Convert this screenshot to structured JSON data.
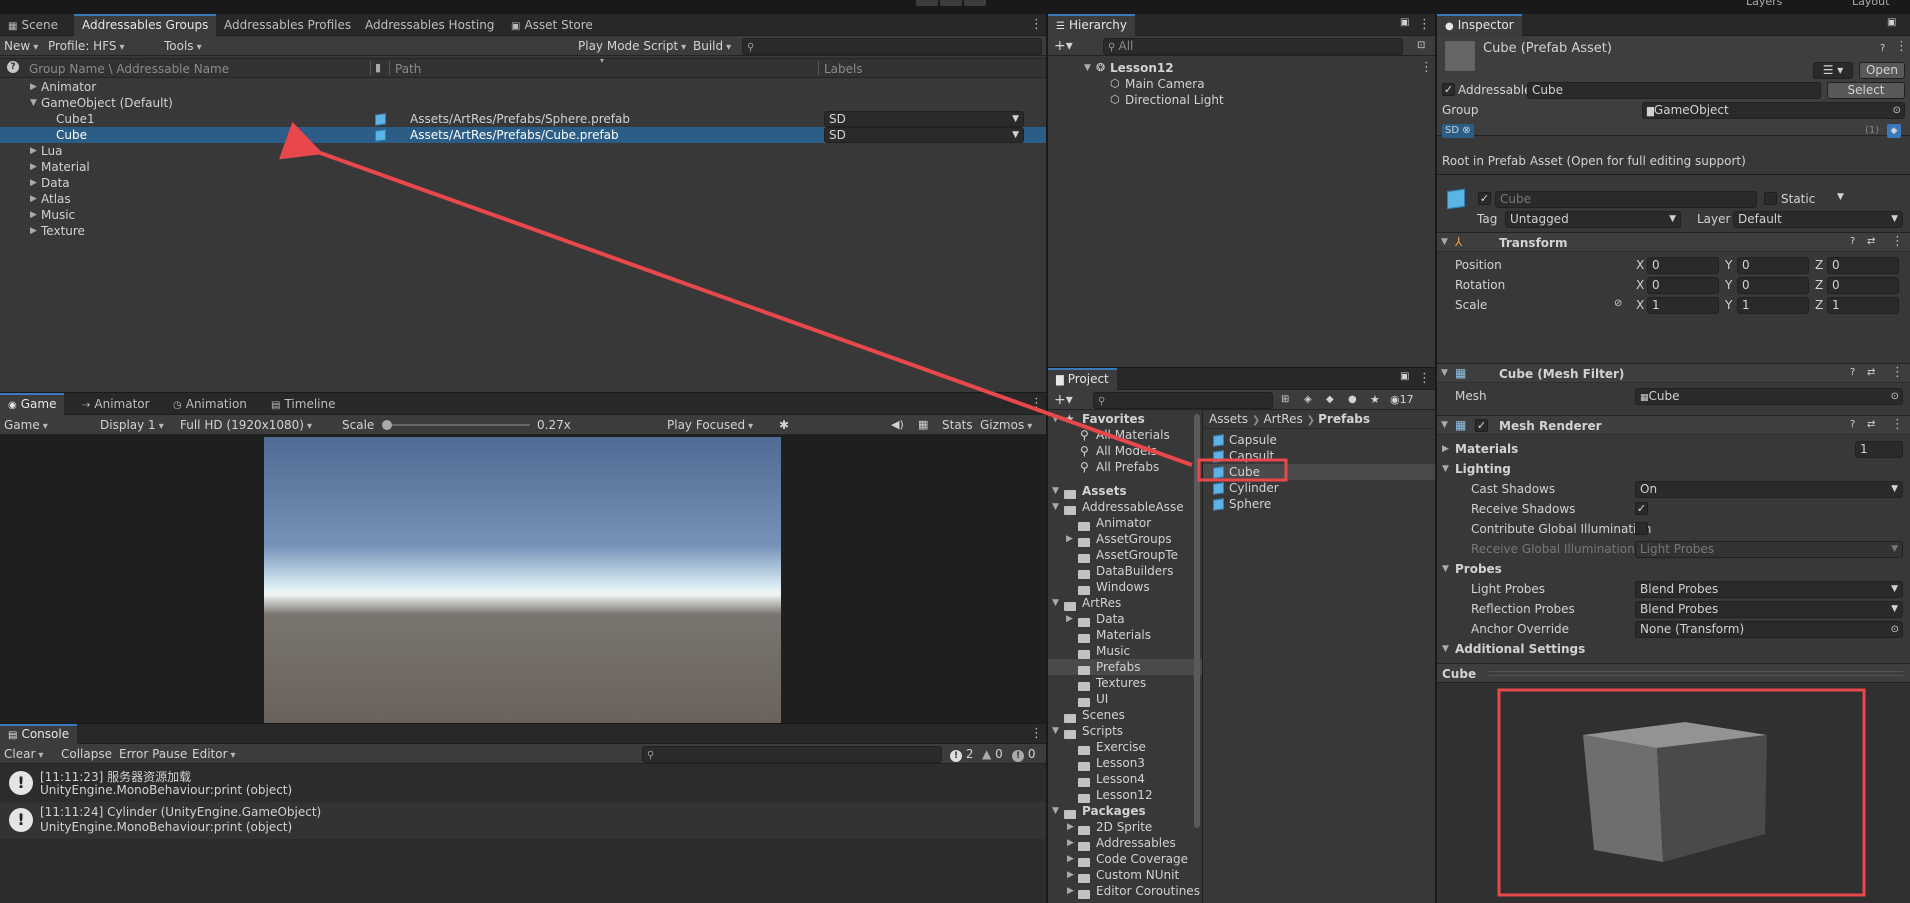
{
  "groups": {
    "tabs": [
      "Scene",
      "Addressables Groups",
      "Addressables Profiles",
      "Addressables Hosting",
      "Asset Store"
    ],
    "new_label": "New",
    "profile_label": "Profile: HFS",
    "tools_label": "Tools",
    "play_mode_label": "Play Mode Script",
    "build_label": "Build",
    "col_name": "Group Name \\ Addressable Name",
    "col_path": "Path",
    "col_labels": "Labels",
    "rows": [
      {
        "name": "Animator"
      },
      {
        "name": "GameObject (Default)"
      },
      {
        "name": "Cube1",
        "path": "Assets/ArtRes/Prefabs/Sphere.prefab",
        "label": "SD"
      },
      {
        "name": "Cube",
        "path": "Assets/ArtRes/Prefabs/Cube.prefab",
        "label": "SD"
      },
      {
        "name": "Lua"
      },
      {
        "name": "Material"
      },
      {
        "name": "Data"
      },
      {
        "name": "Atlas"
      },
      {
        "name": "Music"
      },
      {
        "name": "Texture"
      }
    ]
  },
  "game": {
    "tabs": [
      "Game",
      "Animator",
      "Animation",
      "Timeline"
    ],
    "game_label": "Game",
    "display_label": "Display 1",
    "resolution_label": "Full HD (1920x1080)",
    "scale_label": "Scale",
    "scale_value": "0.27x",
    "play_focused_label": "Play Focused",
    "stats_label": "Stats",
    "gizmos_label": "Gizmos"
  },
  "console": {
    "tab": "Console",
    "clear_label": "Clear",
    "collapse_label": "Collapse",
    "error_pause_label": "Error Pause",
    "editor_label": "Editor",
    "count_info": "2",
    "count_warn": "0",
    "count_err": "0",
    "entries": [
      {
        "line1": "[11:11:23] 服务器资源加载",
        "line2": "UnityEngine.MonoBehaviour:print (object)"
      },
      {
        "line1": "[11:11:24] Cylinder (UnityEngine.GameObject)",
        "line2": "UnityEngine.MonoBehaviour:print (object)"
      }
    ]
  },
  "hierarchy": {
    "tab": "Hierarchy",
    "search_placeholder": "All",
    "scene": "Lesson12",
    "items": [
      "Main Camera",
      "Directional Light"
    ]
  },
  "project": {
    "tab": "Project",
    "badge_count": "17",
    "favorites_label": "Favorites",
    "favorites": [
      "All Materials",
      "All Models",
      "All Prefabs"
    ],
    "assets_label": "Assets",
    "tree": [
      {
        "name": "AddressableAsse",
        "level": 1,
        "arrow": "open"
      },
      {
        "name": "Animator",
        "level": 2,
        "arrow": ""
      },
      {
        "name": "AssetGroups",
        "level": 2,
        "arrow": "closed"
      },
      {
        "name": "AssetGroupTe",
        "level": 2,
        "arrow": ""
      },
      {
        "name": "DataBuilders",
        "level": 2,
        "arrow": ""
      },
      {
        "name": "Windows",
        "level": 2,
        "arrow": ""
      },
      {
        "name": "ArtRes",
        "level": 1,
        "arrow": "open"
      },
      {
        "name": "Data",
        "level": 2,
        "arrow": "closed"
      },
      {
        "name": "Materials",
        "level": 2,
        "arrow": ""
      },
      {
        "name": "Music",
        "level": 2,
        "arrow": ""
      },
      {
        "name": "Prefabs",
        "level": 2,
        "arrow": "",
        "selected": true
      },
      {
        "name": "Textures",
        "level": 2,
        "arrow": ""
      },
      {
        "name": "UI",
        "level": 2,
        "arrow": ""
      },
      {
        "name": "Scenes",
        "level": 1,
        "arrow": ""
      },
      {
        "name": "Scripts",
        "level": 1,
        "arrow": "open"
      },
      {
        "name": "Exercise",
        "level": 2,
        "arrow": ""
      },
      {
        "name": "Lesson3",
        "level": 2,
        "arrow": ""
      },
      {
        "name": "Lesson4",
        "level": 2,
        "arrow": ""
      },
      {
        "name": "Lesson12",
        "level": 2,
        "arrow": ""
      }
    ],
    "packages_label": "Packages",
    "packages": [
      "2D Sprite",
      "Addressables",
      "Code Coverage",
      "Custom NUnit",
      "Editor Coroutines"
    ],
    "breadcrumb": [
      "Assets",
      "ArtRes",
      "Prefabs"
    ],
    "files": [
      "Capsule",
      "Capsult",
      "Cube",
      "Cylinder",
      "Sphere"
    ]
  },
  "inspector": {
    "tab": "Inspector",
    "title": "Cube (Prefab Asset)",
    "open_label": "Open",
    "addressable_label": "Addressable",
    "addressable_value": "Cube",
    "select_label": "Select",
    "group_label": "Group",
    "group_value": "GameObject",
    "label_tag": "SD",
    "label_count": "(1)",
    "root_note": "Root in Prefab Asset (Open for full editing support)",
    "name_value": "Cube",
    "static_label": "Static",
    "tag_label": "Tag",
    "tag_value": "Untagged",
    "layer_label": "Layer",
    "layer_value": "Default",
    "transform_title": "Transform",
    "position_label": "Position",
    "rotation_label": "Rotation",
    "scale_label": "Scale",
    "axis_x": "X",
    "axis_y": "Y",
    "axis_z": "Z",
    "position": [
      "0",
      "0",
      "0"
    ],
    "rotation": [
      "0",
      "0",
      "0"
    ],
    "scale": [
      "1",
      "1",
      "1"
    ],
    "mesh_filter_title": "Cube (Mesh Filter)",
    "mesh_label": "Mesh",
    "mesh_value": "Cube",
    "renderer_title": "Mesh Renderer",
    "materials_label": "Materials",
    "materials_count": "1",
    "lighting_label": "Lighting",
    "cast_shadows_label": "Cast Shadows",
    "cast_shadows_value": "On",
    "receive_shadows_label": "Receive Shadows",
    "contribute_gi_label": "Contribute Global Illumination",
    "receive_gi_label": "Receive Global Illumination",
    "receive_gi_value": "Light Probes",
    "probes_label": "Probes",
    "light_probes_label": "Light Probes",
    "light_probes_value": "Blend Probes",
    "reflection_probes_label": "Reflection Probes",
    "reflection_probes_value": "Blend Probes",
    "anchor_override_label": "Anchor Override",
    "anchor_override_value": "None (Transform)",
    "additional_settings_label": "Additional Settings",
    "preview_title": "Cube"
  },
  "topbar": {
    "layers_label": "Layers",
    "layout_label": "Layout"
  },
  "annotation_color": "#e8474b"
}
